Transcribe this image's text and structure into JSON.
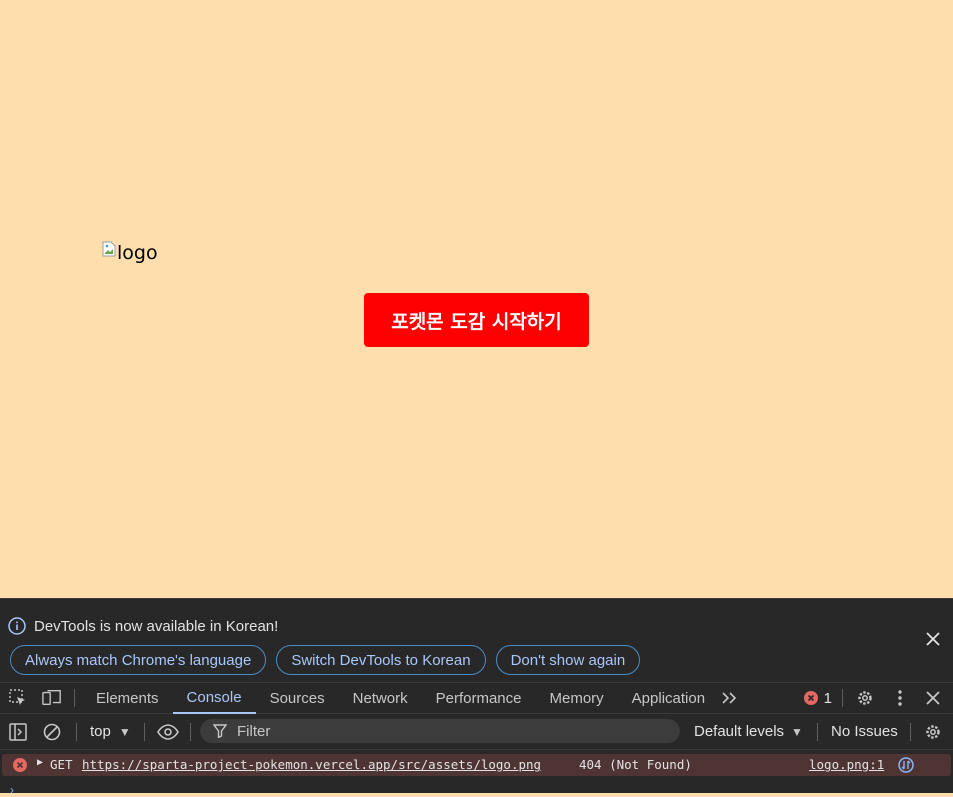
{
  "page": {
    "logo_alt": "logo",
    "start_button": "포켓몬 도감 시작하기",
    "background": "#ffdead",
    "button_color": "#ff0000"
  },
  "devtools": {
    "infobar": {
      "message": "DevTools is now available in Korean!",
      "buttons": [
        "Always match Chrome's language",
        "Switch DevTools to Korean",
        "Don't show again"
      ]
    },
    "tabs": [
      "Elements",
      "Console",
      "Sources",
      "Network",
      "Performance",
      "Memory",
      "Application"
    ],
    "active_tab": "Console",
    "error_count": "1",
    "toolbar": {
      "context": "top",
      "filter_placeholder": "Filter",
      "levels": "Default levels",
      "issues": "No Issues"
    },
    "console": {
      "method": "GET",
      "url": "https://sparta-project-pokemon.vercel.app/src/assets/logo.png",
      "status": "404 (Not Found)",
      "source": "logo.png:1"
    }
  }
}
